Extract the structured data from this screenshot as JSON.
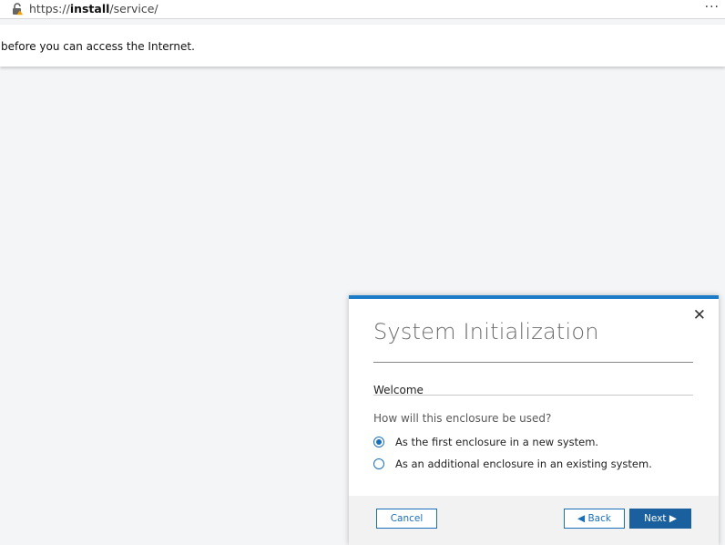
{
  "browser": {
    "url_prefix": "https://",
    "url_host": "install",
    "url_path": "/service/",
    "more_label": "···"
  },
  "notice": {
    "text": "before you can access the Internet."
  },
  "dialog": {
    "title": "System Initialization",
    "close_glyph": "✕",
    "step_label": "Welcome",
    "question": "How will this enclosure be used?",
    "options": [
      {
        "label": "As the first enclosure in a new system.",
        "selected": true
      },
      {
        "label": "As an additional enclosure in an existing system.",
        "selected": false
      }
    ],
    "buttons": {
      "cancel": "Cancel",
      "back": "◀ Back",
      "next": "Next ▶"
    }
  },
  "colors": {
    "accent": "#1a7bc8",
    "primary_button": "#1a5f9e",
    "page_bg": "#f4f5f7"
  },
  "icons": [
    "lock-warning-icon",
    "more-icon",
    "close-icon",
    "radio-checked-icon",
    "radio-unchecked-icon"
  ]
}
